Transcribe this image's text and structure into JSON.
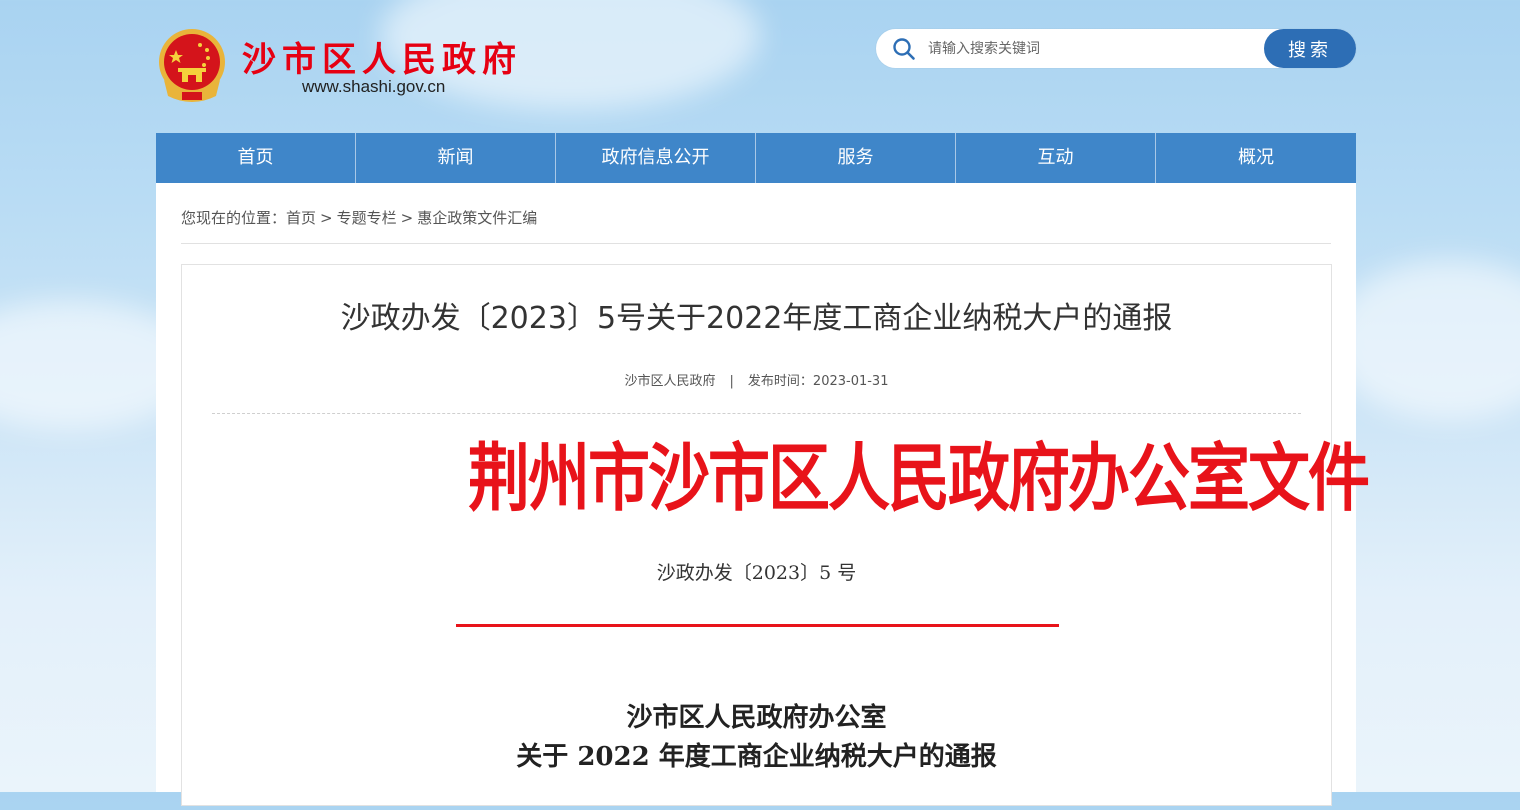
{
  "site": {
    "title": "沙市区人民政府",
    "url": "www.shashi.gov.cn",
    "emblem_icon": "national-emblem-icon",
    "title_color": "#e60012"
  },
  "search": {
    "placeholder": "请输入搜索关键词",
    "button_label": "搜索",
    "icon": "search-icon",
    "button_color": "#2d6eb5"
  },
  "nav": {
    "color": "#3f86c9",
    "items": [
      {
        "label": "首页"
      },
      {
        "label": "新闻"
      },
      {
        "label": "政府信息公开"
      },
      {
        "label": "服务"
      },
      {
        "label": "互动"
      },
      {
        "label": "概况"
      }
    ]
  },
  "breadcrumb": {
    "prefix": "您现在的位置：",
    "items": [
      "首页",
      "专题专栏",
      "惠企政策文件汇编"
    ],
    "separator": ">"
  },
  "article": {
    "title": "沙政办发〔2023〕5号关于2022年度工商企业纳税大户的通报",
    "source": "沙市区人民政府",
    "divider": "|",
    "publish_label": "发布时间：",
    "publish_date": "2023-01-31"
  },
  "document": {
    "header": "荆州市沙市区人民政府办公室文件",
    "number": "沙政办发〔2023〕5 号",
    "issuer": "沙市区人民政府办公室",
    "subject": "关于 2022 年度工商企业纳税大户的通报",
    "header_color": "#e8131a"
  }
}
